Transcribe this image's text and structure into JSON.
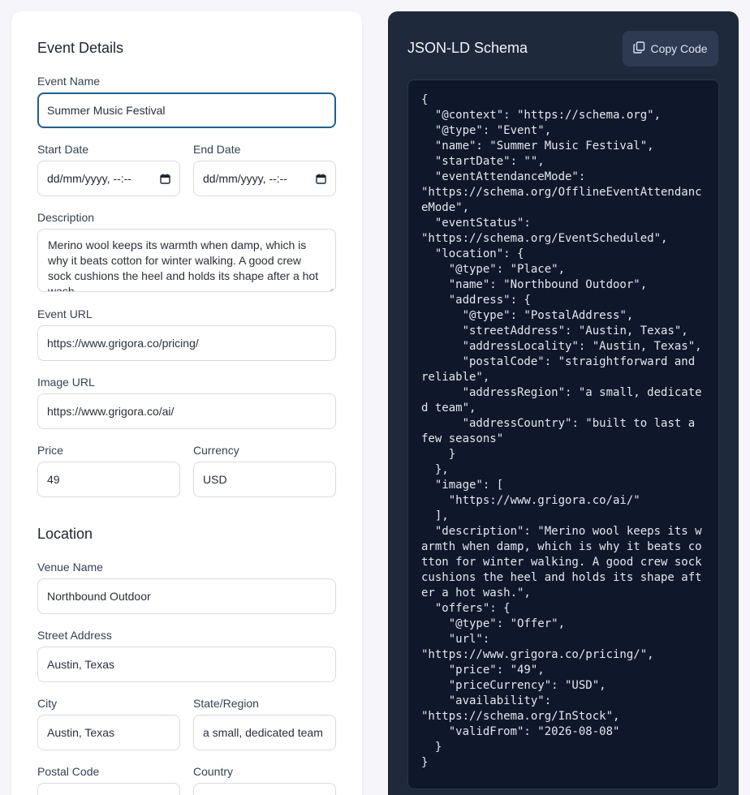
{
  "form": {
    "event_details_title": "Event Details",
    "event_name_label": "Event Name",
    "event_name_value": "Summer Music Festival",
    "start_date_label": "Start Date",
    "start_date_value": "dd/mm/yyyy, --:--",
    "end_date_label": "End Date",
    "end_date_value": "dd/mm/yyyy, --:--",
    "description_label": "Description",
    "description_value": "Merino wool keeps its warmth when damp, which is why it beats cotton for winter walking. A good crew sock cushions the heel and holds its shape after a hot wash.",
    "event_url_label": "Event URL",
    "event_url_value": "https://www.grigora.co/pricing/",
    "image_url_label": "Image URL",
    "image_url_value": "https://www.grigora.co/ai/",
    "price_label": "Price",
    "price_value": "49",
    "currency_label": "Currency",
    "currency_value": "USD",
    "location_title": "Location",
    "venue_label": "Venue Name",
    "venue_value": "Northbound Outdoor",
    "street_label": "Street Address",
    "street_value": "Austin, Texas",
    "city_label": "City",
    "city_value": "Austin, Texas",
    "state_label": "State/Region",
    "state_value": "a small, dedicated team",
    "postal_label": "Postal Code",
    "country_label": "Country"
  },
  "schema_panel": {
    "title": "JSON-LD Schema",
    "copy_label": "Copy Code",
    "code": "{\n  \"@context\": \"https://schema.org\",\n  \"@type\": \"Event\",\n  \"name\": \"Summer Music Festival\",\n  \"startDate\": \"\",\n  \"eventAttendanceMode\":\n\"https://schema.org/OfflineEventAttendanceMode\",\n  \"eventStatus\":\n\"https://schema.org/EventScheduled\",\n  \"location\": {\n    \"@type\": \"Place\",\n    \"name\": \"Northbound Outdoor\",\n    \"address\": {\n      \"@type\": \"PostalAddress\",\n      \"streetAddress\": \"Austin, Texas\",\n      \"addressLocality\": \"Austin, Texas\",\n      \"postalCode\": \"straightforward and reliable\",\n      \"addressRegion\": \"a small, dedicated team\",\n      \"addressCountry\": \"built to last a few seasons\"\n    }\n  },\n  \"image\": [\n    \"https://www.grigora.co/ai/\"\n  ],\n  \"description\": \"Merino wool keeps its warmth when damp, which is why it beats cotton for winter walking. A good crew sock cushions the heel and holds its shape after a hot wash.\",\n  \"offers\": {\n    \"@type\": \"Offer\",\n    \"url\":\n\"https://www.grigora.co/pricing/\",\n    \"price\": \"49\",\n    \"priceCurrency\": \"USD\",\n    \"availability\":\n\"https://schema.org/InStock\",\n    \"validFrom\": \"2026-08-08\"\n  }\n}"
  },
  "icons": {
    "calendar": "calendar-icon",
    "copy": "copy-icon"
  },
  "colors": {
    "focus_border": "#1f5f8b",
    "code_panel_bg": "#1e293b",
    "code_box_bg": "#0f172a"
  }
}
